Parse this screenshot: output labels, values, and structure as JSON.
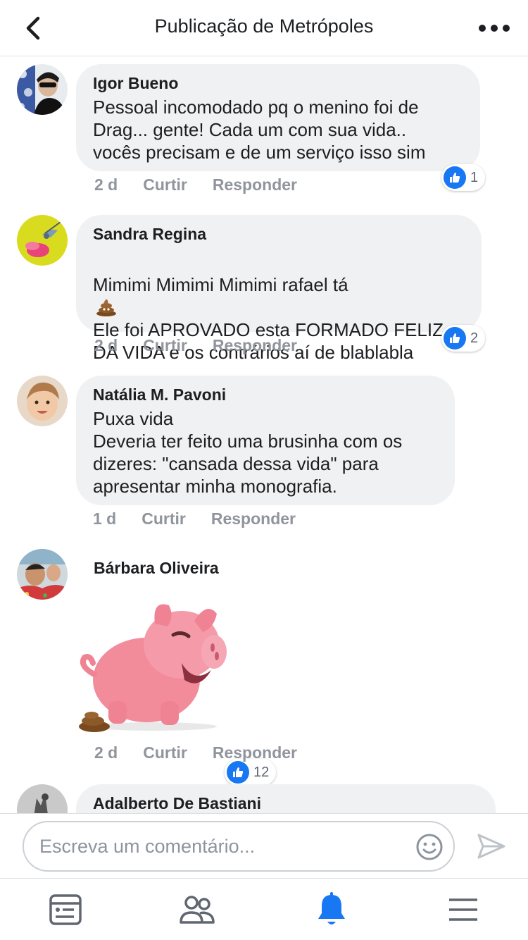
{
  "header": {
    "title": "Publicação de Metrópoles"
  },
  "comments": [
    {
      "author": "Igor Bueno",
      "text": "Pessoal incomodado pq o menino foi de\nDrag... gente! Cada um com sua vida..\nvocês precisam e de um serviço isso sim",
      "time": "2 d",
      "like_label": "Curtir",
      "reply_label": "Responder",
      "reactions": "1"
    },
    {
      "author": "Sandra Regina",
      "text_line1": "Mimimi  Mimimi Mimimi rafael tá",
      "text_rest": "Ele foi APROVADO esta FORMADO FELIZ\nDA VIDA e os contrários aí de blablabla",
      "time": "2 d",
      "like_label": "Curtir",
      "reply_label": "Responder",
      "reactions": "2"
    },
    {
      "author": "Natália M. Pavoni",
      "text": "Puxa vida\nDeveria ter feito uma brusinha com os\ndizeres: \"cansada dessa vida\" para\napresentar minha monografia.",
      "time": "1 d",
      "like_label": "Curtir",
      "reply_label": "Responder"
    },
    {
      "author": "Bárbara Oliveira",
      "sticker": "pig-sticker",
      "time": "2 d",
      "like_label": "Curtir",
      "reply_label": "Responder",
      "reactions": "12"
    },
    {
      "author": "Adalberto De Bastiani"
    }
  ],
  "composer": {
    "placeholder": "Escreva um comentário..."
  },
  "icons": {
    "back": "chevron-left-icon",
    "more": "more-horizontal-icon",
    "like": "thumbs-up-icon",
    "emoji": "smiley-icon",
    "send": "send-icon",
    "nav": [
      "news-feed-icon",
      "friends-icon",
      "notifications-bell-icon",
      "menu-icon"
    ]
  },
  "colors": {
    "accent": "#1877f2",
    "bubble": "#f0f1f3",
    "meta_text": "#90949c"
  }
}
